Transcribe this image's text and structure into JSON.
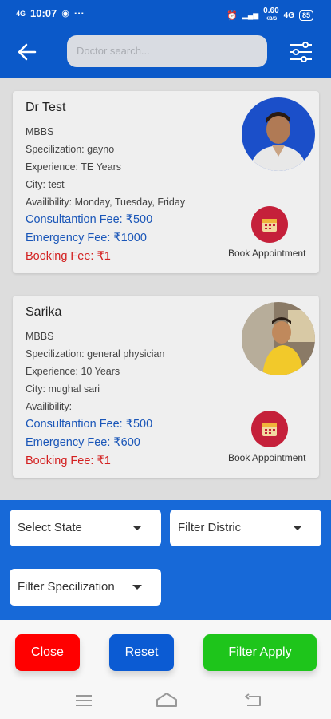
{
  "status": {
    "time": "10:07",
    "net_left": "4G",
    "speed": "0.60",
    "speed_unit": "KB/S",
    "net_right": "4G",
    "battery": "85"
  },
  "header": {
    "search_placeholder": "Doctor search..."
  },
  "doctors": [
    {
      "name": "Dr Test",
      "degree": "MBBS",
      "specialization": "Specilization: gayno",
      "experience": "Experience: TE Years",
      "city": "City: test",
      "availability": "Availibility: Monday, Tuesday, Friday",
      "consultation_fee": "Consultantion Fee:  ₹500",
      "emergency_fee": "Emergency Fee:  ₹1000",
      "booking_fee": "Booking Fee:  ₹1",
      "book_label": "Book Appointment"
    },
    {
      "name": "Sarika",
      "degree": "MBBS",
      "specialization": "Specilization: general physician",
      "experience": "Experience: 10 Years",
      "city": "City: mughal sari",
      "availability": "Availibility:",
      "consultation_fee": "Consultantion Fee:  ₹500",
      "emergency_fee": "Emergency Fee:  ₹600",
      "booking_fee": "Booking Fee:  ₹1",
      "book_label": "Book Appointment"
    }
  ],
  "filters": {
    "state": "Select State",
    "district": "Filter Distric",
    "specialization": "Filter Specilization"
  },
  "actions": {
    "close": "Close",
    "reset": "Reset",
    "apply": "Filter Apply"
  },
  "colors": {
    "primary": "#0b59c9",
    "panel": "#1769d8",
    "close": "#ff0000",
    "reset": "#0b5bd3",
    "apply": "#1ec51b",
    "fee_blue": "#1a56b8",
    "fee_red": "#d32020"
  }
}
